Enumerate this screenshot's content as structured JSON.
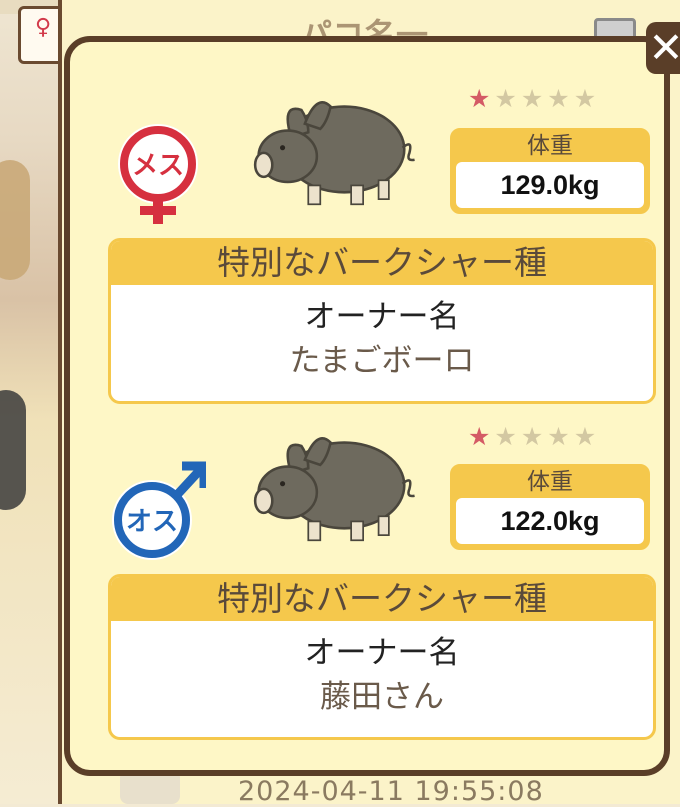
{
  "background": {
    "title_fragment": "パコ名一",
    "date": "2024-04-11 19:55:08",
    "sex_chip_glyph": "♀"
  },
  "close_button": {
    "label": "✕"
  },
  "pigs": [
    {
      "sex": "female",
      "sex_label": "メス",
      "sex_color": "#d6303f",
      "stars_filled": 1,
      "stars_total": 5,
      "weight_label": "体重",
      "weight_value": "129.0kg",
      "breed": "特別なバークシャー種",
      "owner_label": "オーナー名",
      "owner_name": "たまごボーロ"
    },
    {
      "sex": "male",
      "sex_label": "オス",
      "sex_color": "#2266b8",
      "stars_filled": 1,
      "stars_total": 5,
      "weight_label": "体重",
      "weight_value": "122.0kg",
      "breed": "特別なバークシャー種",
      "owner_label": "オーナー名",
      "owner_name": "藤田さん"
    }
  ],
  "colors": {
    "frame": "#5a3e28",
    "panel": "#fef7c6",
    "accent_yellow": "#f5c84c",
    "star_on": "#d45b65",
    "star_off": "#d3c8a2",
    "pig_body": "#6e6a5e"
  }
}
